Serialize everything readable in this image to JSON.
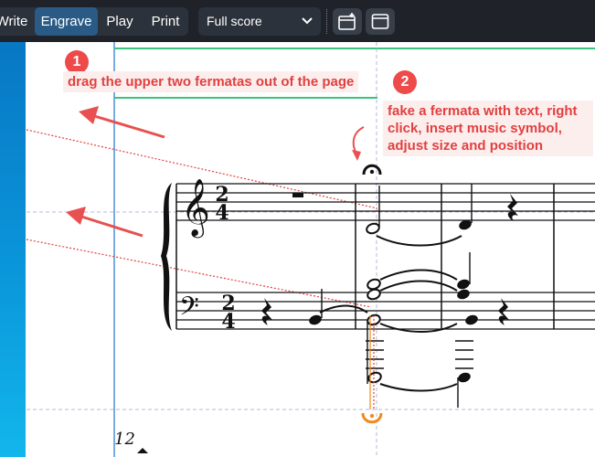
{
  "toolbar": {
    "modes": [
      {
        "label": "Write",
        "active": false
      },
      {
        "label": "Engrave",
        "active": true
      },
      {
        "label": "Play",
        "active": false
      },
      {
        "label": "Print",
        "active": false
      }
    ],
    "layout_select": {
      "value": "Full score",
      "icon": "chevron-down-icon"
    },
    "buttons": [
      {
        "name": "add-layout-button",
        "icon": "add-frame-icon"
      },
      {
        "name": "window-button",
        "icon": "window-icon"
      }
    ]
  },
  "annotations": [
    {
      "number": "1",
      "text": "drag the upper two fermatas out of the page"
    },
    {
      "number": "2",
      "lines": [
        "fake a fermata with text, right",
        "click, insert music symbol,",
        "adjust size and position"
      ]
    }
  ],
  "score": {
    "treble_time_signature": {
      "top": "2",
      "bottom": "4"
    },
    "bass_time_signature": {
      "top": "2",
      "bottom": "4"
    },
    "measure_number": "12"
  },
  "colors": {
    "toolbar_bg": "#1f2329",
    "active_mode": "#2a5b86",
    "annotation_red": "#ee4a4a",
    "annotation_text": "#e0413f",
    "frame_green": "#3ac27f",
    "selection_orange": "#f28a1c",
    "margin_blue": "#4a90d9"
  }
}
